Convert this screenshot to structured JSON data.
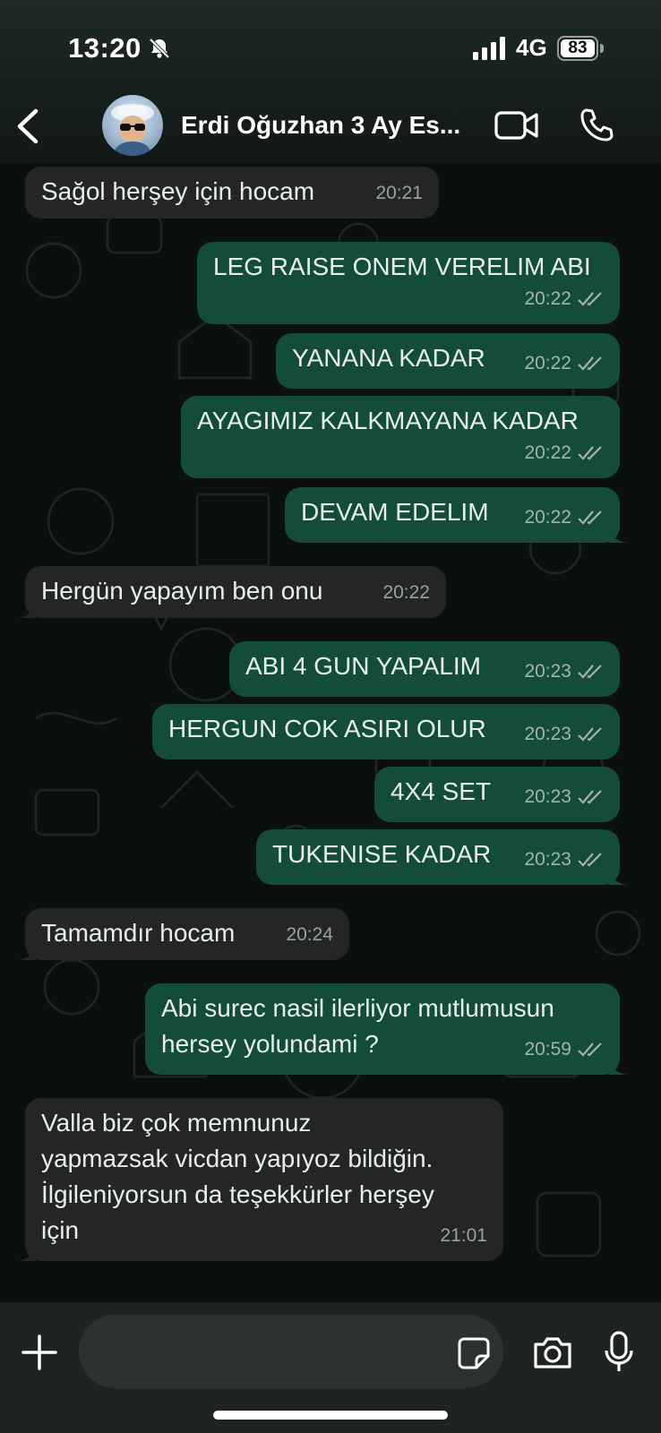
{
  "status_bar": {
    "time": "13:20",
    "network": "4G",
    "battery": "83",
    "mute_icon": "bell-slash-icon",
    "signal_icon": "cellular-signal-icon"
  },
  "header": {
    "contact_name": "Erdi Oğuzhan 3 Ay Es...",
    "back_icon": "chevron-left-icon",
    "video_icon": "video-camera-icon",
    "call_icon": "phone-icon"
  },
  "colors": {
    "incoming_bubble": "#242626",
    "outgoing_bubble": "#134d37",
    "background": "#0b0f0e"
  },
  "messages": [
    {
      "direction": "in",
      "text": "Sağol herşey için hocam",
      "time": "20:21"
    },
    {
      "direction": "out",
      "text": "LEG RAISE ONEM VERELIM ABI",
      "time": "20:22",
      "read": true
    },
    {
      "direction": "out",
      "text": "YANANA KADAR",
      "time": "20:22",
      "read": true
    },
    {
      "direction": "out",
      "text": "AYAGIMIZ KALKMAYANA KADAR",
      "time": "20:22",
      "read": true
    },
    {
      "direction": "out",
      "text": "DEVAM EDELIM",
      "time": "20:22",
      "read": true
    },
    {
      "direction": "in",
      "text": "Hergün yapayım ben onu",
      "time": "20:22"
    },
    {
      "direction": "out",
      "text": "ABI 4 GUN YAPALIM",
      "time": "20:23",
      "read": true
    },
    {
      "direction": "out",
      "text": "HERGUN COK ASIRI OLUR",
      "time": "20:23",
      "read": true
    },
    {
      "direction": "out",
      "text": "4X4 SET",
      "time": "20:23",
      "read": true
    },
    {
      "direction": "out",
      "text": "TUKENISE KADAR",
      "time": "20:23",
      "read": true
    },
    {
      "direction": "in",
      "text": "Tamamdır hocam",
      "time": "20:24"
    },
    {
      "direction": "out",
      "text": "Abi surec nasil ilerliyor mutlumusun\nhersey yolundami ?",
      "time": "20:59",
      "read": true
    },
    {
      "direction": "in",
      "text": "Valla biz çok memnunuz\nyapmazsak vicdan yapıyoz bildiğin.\nİlgileniyorsun da teşekkürler herşey\niçin",
      "time": "21:01"
    }
  ],
  "composer": {
    "placeholder": "",
    "plus_icon": "plus-icon",
    "sticker_icon": "sticker-icon",
    "camera_icon": "camera-icon",
    "mic_icon": "microphone-icon"
  }
}
